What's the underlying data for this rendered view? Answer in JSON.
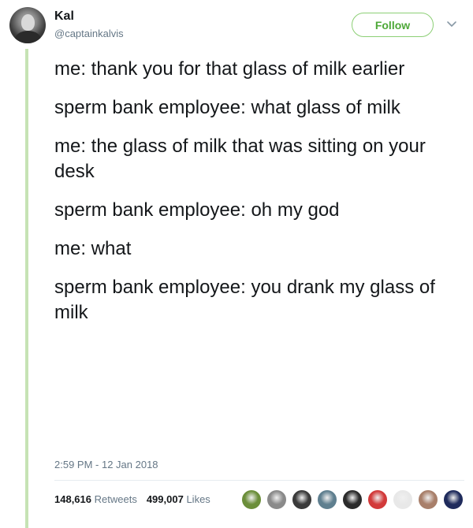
{
  "author": {
    "name": "Kal",
    "handle": "@captainkalvis"
  },
  "follow_button": {
    "label": "Follow"
  },
  "menu_icon": "chevron-down-icon",
  "tweet": {
    "lines": [
      "me: thank you for that glass of milk earlier",
      "sperm bank employee: what glass of milk",
      "me: the glass of milk that was sitting on your desk",
      "sperm bank employee: oh my god",
      "me: what",
      "sperm bank employee: you drank my glass of milk"
    ],
    "timestamp": "2:59 PM - 12 Jan 2018"
  },
  "stats": {
    "retweets_count": "148,616",
    "retweets_label": "Retweets",
    "likes_count": "499,007",
    "likes_label": "Likes"
  },
  "likers": [
    {
      "icon": "liker-avatar-1",
      "color": "#6b8e3a"
    },
    {
      "icon": "liker-avatar-2",
      "color": "#8a8a8a"
    },
    {
      "icon": "liker-avatar-3",
      "color": "#3a3a3a"
    },
    {
      "icon": "liker-avatar-4",
      "color": "#5f7f8f"
    },
    {
      "icon": "liker-avatar-5",
      "color": "#2b2b2b"
    },
    {
      "icon": "liker-avatar-6",
      "color": "#d23a3a"
    },
    {
      "icon": "liker-avatar-7",
      "color": "#e8e8e8"
    },
    {
      "icon": "liker-avatar-8",
      "color": "#a87f6a"
    },
    {
      "icon": "liker-avatar-9",
      "color": "#1f2b5c"
    }
  ],
  "colors": {
    "thread_line": "#c6e3b4",
    "follow_accent": "#4ea838",
    "secondary_text": "#657786"
  }
}
